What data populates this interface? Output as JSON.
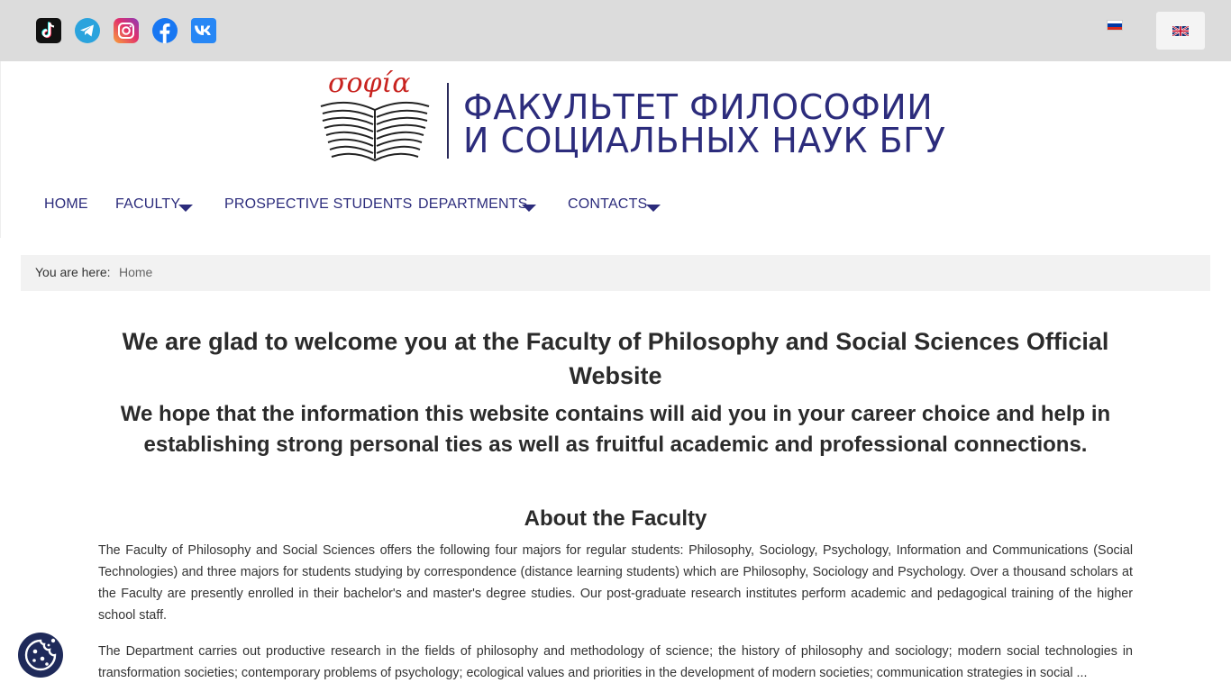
{
  "topbar": {
    "social_icons": [
      "tiktok-icon",
      "telegram-icon",
      "instagram-icon",
      "facebook-icon",
      "vk-icon"
    ],
    "languages": [
      "ru-flag-icon",
      "en-flag-icon"
    ]
  },
  "logo": {
    "wordmark": "σοφία",
    "line1": "ФАКУЛЬТЕТ ФИЛОСОФИИ",
    "line2": "И СОЦИАЛЬНЫХ НАУК БГУ"
  },
  "nav": {
    "items": [
      {
        "label": "HOME",
        "has_dropdown": false
      },
      {
        "label": "FACULTY",
        "has_dropdown": true
      },
      {
        "label": "PROSPECTIVE STUDENTS",
        "has_dropdown": false
      },
      {
        "label": "DEPARTMENTS",
        "has_dropdown": true
      },
      {
        "label": "CONTACTS",
        "has_dropdown": true
      }
    ]
  },
  "breadcrumb": {
    "label": "You are here:",
    "current": "Home"
  },
  "main": {
    "welcome_title": "We are glad to welcome you at the Faculty of Philosophy and Social Sciences Official Website",
    "welcome_subtitle": "We hope that the information this website contains will aid you in your career choice and help in establishing strong personal ties as well as fruitful academic and professional connections.",
    "about_title": "About the Faculty",
    "paragraph1": "The Faculty of Philosophy and Social Sciences offers the following four majors for regular students: Philosophy, Sociology, Psychology, Information and Communications (Social Technologies) and three majors for students studying by correspondence (distance learning students) which are Philosophy, Sociology and Psychology. Over a thousand scholars at the Faculty are presently enrolled in their bachelor's and master's degree studies. Our post-graduate research institutes perform academic and pedagogical training of the higher school staff.",
    "paragraph2": "The Department carries out productive research in the fields of philosophy and methodology of science; the history of philosophy and sociology; modern social technologies in transformation societies; contemporary problems of psychology; ecological values and priorities in the development of modern societies; communication strategies in social ..."
  },
  "cookie": {
    "icon": "cookie-icon"
  },
  "colors": {
    "nav_text": "#2c2c7c",
    "topbar_bg": "#dcdcdc",
    "logo_red": "#c8231f",
    "cookie_bg": "#1f2a5a"
  }
}
